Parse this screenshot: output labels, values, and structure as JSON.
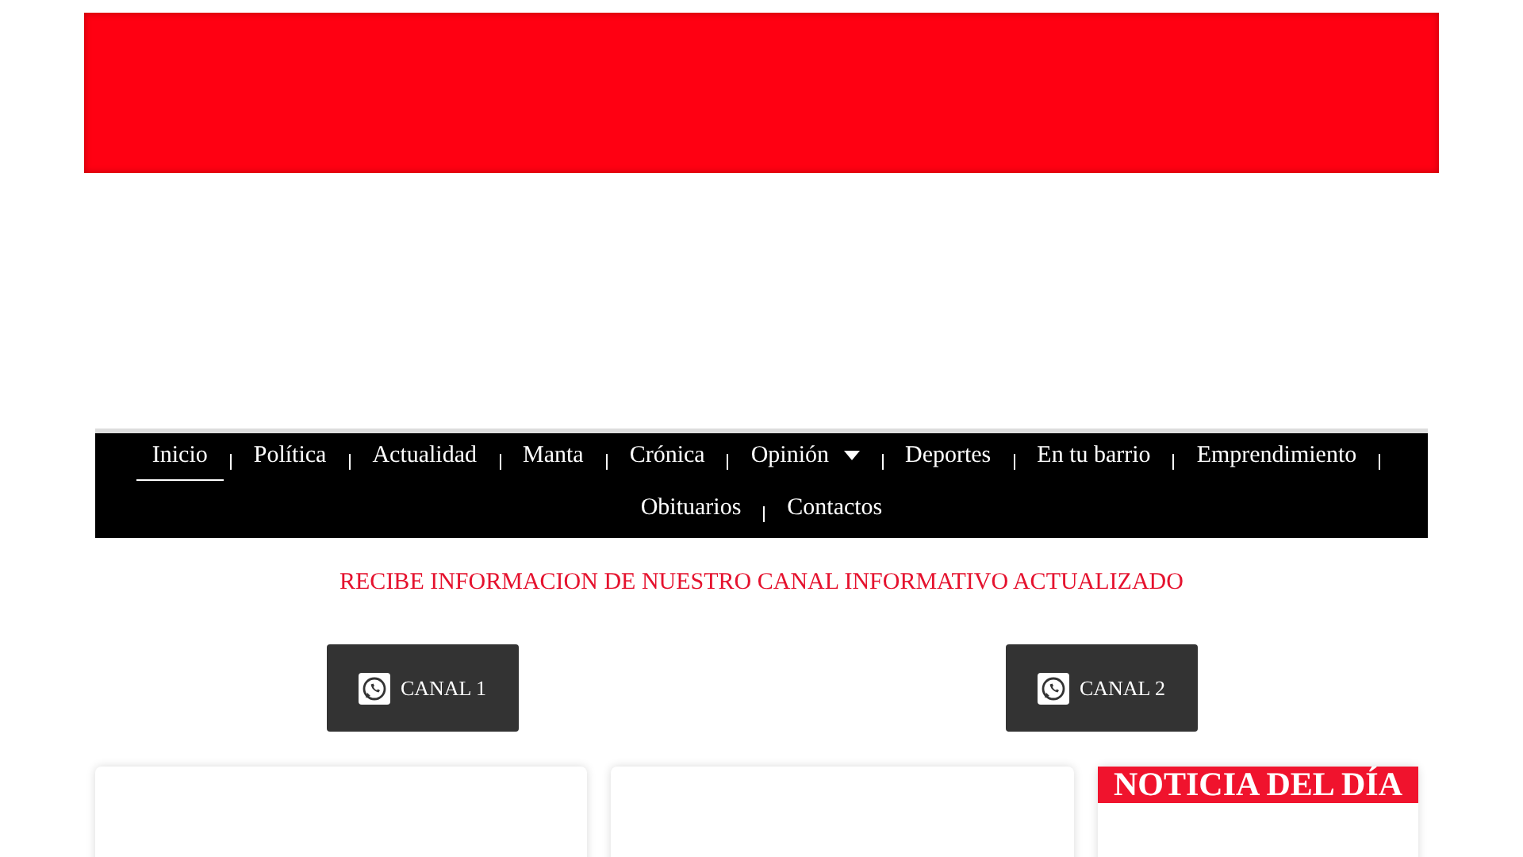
{
  "nav": {
    "items": [
      {
        "label": "Inicio",
        "selected": true,
        "kind": "link"
      },
      {
        "label": "Política",
        "selected": false,
        "kind": "link"
      },
      {
        "label": "Actualidad",
        "selected": false,
        "kind": "link"
      },
      {
        "label": "Manta",
        "selected": false,
        "kind": "link"
      },
      {
        "label": "Crónica",
        "selected": false,
        "kind": "link"
      },
      {
        "label": "Opinión",
        "selected": false,
        "kind": "dropdown"
      },
      {
        "label": "Deportes",
        "selected": false,
        "kind": "link"
      },
      {
        "label": "En tu barrio",
        "selected": false,
        "kind": "link"
      },
      {
        "label": "Emprendimiento",
        "selected": false,
        "kind": "link"
      },
      {
        "label": "Obituarios",
        "selected": false,
        "kind": "link"
      },
      {
        "label": "Contactos",
        "selected": false,
        "kind": "link"
      }
    ]
  },
  "promo": {
    "heading": "RECIBE INFORMACION DE NUESTRO CANAL INFORMATIVO ACTUALIZADO",
    "buttons": [
      "CANAL 1",
      "CANAL 2"
    ]
  },
  "sidebar": {
    "title": "NOTICIA DEL DÍA"
  }
}
